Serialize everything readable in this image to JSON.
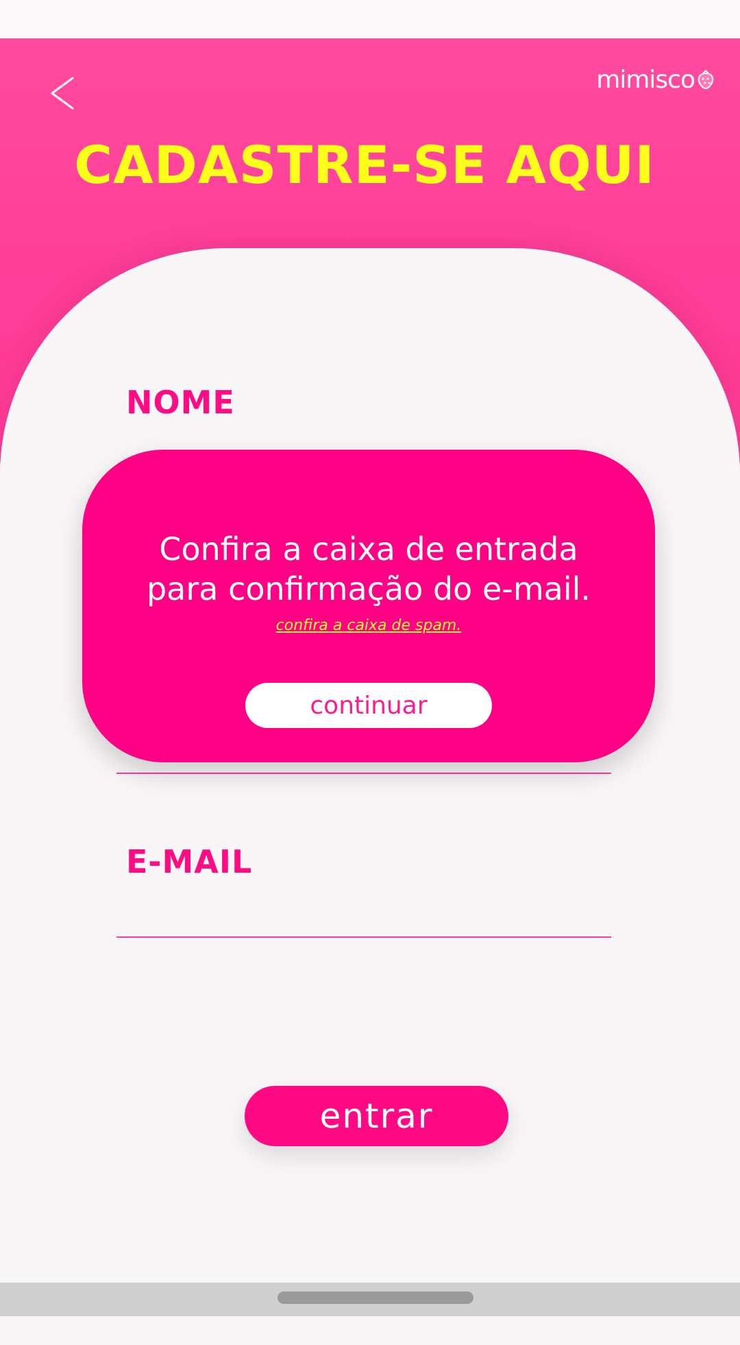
{
  "header": {
    "title": "CADASTRE-SE AQUI",
    "logo_text": "mimisco",
    "back_icon": "chevron-left-icon"
  },
  "form": {
    "name_label": "NOME",
    "email_label": "E-MAIL",
    "submit_label": "entrar"
  },
  "dialog": {
    "message_line1": "Confira a caixa de entrada",
    "message_line2": "para confirmação do e-mail.",
    "spam_link": "confira a caixa de spam.",
    "continue_label": "continuar"
  },
  "colors": {
    "brand_pink": "#ff0184",
    "header_pink": "#ff4b9f",
    "title_yellow": "#ffff1a",
    "background": "#f9f6f7"
  }
}
